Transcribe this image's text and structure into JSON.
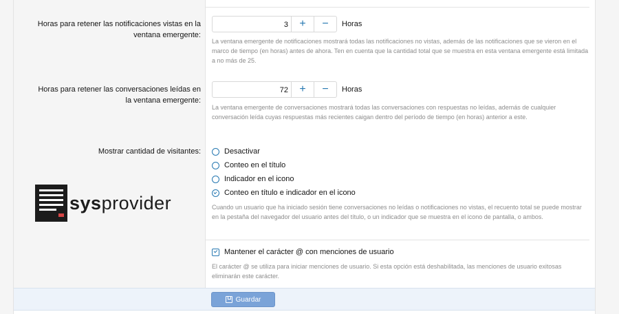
{
  "fields": {
    "notifications": {
      "label_line1": "Horas para retener las notificaciones vistas en la",
      "label_line2": "ventana emergente:",
      "value": "3",
      "plus": "+",
      "minus": "−",
      "unit": "Horas",
      "help": "La ventana emergente de notificaciones mostrará todas las notificaciones no vistas, además de las notificaciones que se vieron en el marco de tiempo (en horas) antes de ahora. Ten en cuenta que la cantidad total que se muestra en esta ventana emergente está limitada a no más de 25."
    },
    "conversations": {
      "label_line1": "Horas para retener las conversaciones leídas en",
      "label_line2": "la ventana emergente:",
      "value": "72",
      "plus": "+",
      "minus": "−",
      "unit": "Horas",
      "help": "La ventana emergente de conversaciones mostrará todas las conversaciones con respuestas no leídas, además de cualquier conversación leída cuyas respuestas más recientes caigan dentro del período de tiempo (en horas) anterior a este."
    },
    "visitor_count": {
      "label": "Mostrar cantidad de visitantes:",
      "options": [
        {
          "label": "Desactivar",
          "checked": false
        },
        {
          "label": "Conteo en el título",
          "checked": false
        },
        {
          "label": "Indicador en el icono",
          "checked": false
        },
        {
          "label": "Conteo en título e indicador en el icono",
          "checked": true
        }
      ],
      "help": "Cuando un usuario que ha iniciado sesión tiene conversaciones no leídas o notificaciones no vistas, el recuento total se puede mostrar en la pestaña del navegador del usuario antes del título, o un indicador que se muestra en el icono de pantalla, o ambos."
    },
    "mentions": {
      "label": "Mantener el carácter @ con menciones de usuario",
      "checked": true,
      "help": "El carácter @ se utiliza para iniciar menciones de usuario. Si esta opción está deshabilitada, las menciones de usuario exitosas eliminarán este carácter."
    }
  },
  "logo": {
    "bold": "sys",
    "regular": "provider"
  },
  "footer": {
    "save_label": "Guardar"
  },
  "colors": {
    "accent": "#2577b1",
    "button": "#7aa3d8",
    "footer_bg": "#edf3fa"
  }
}
